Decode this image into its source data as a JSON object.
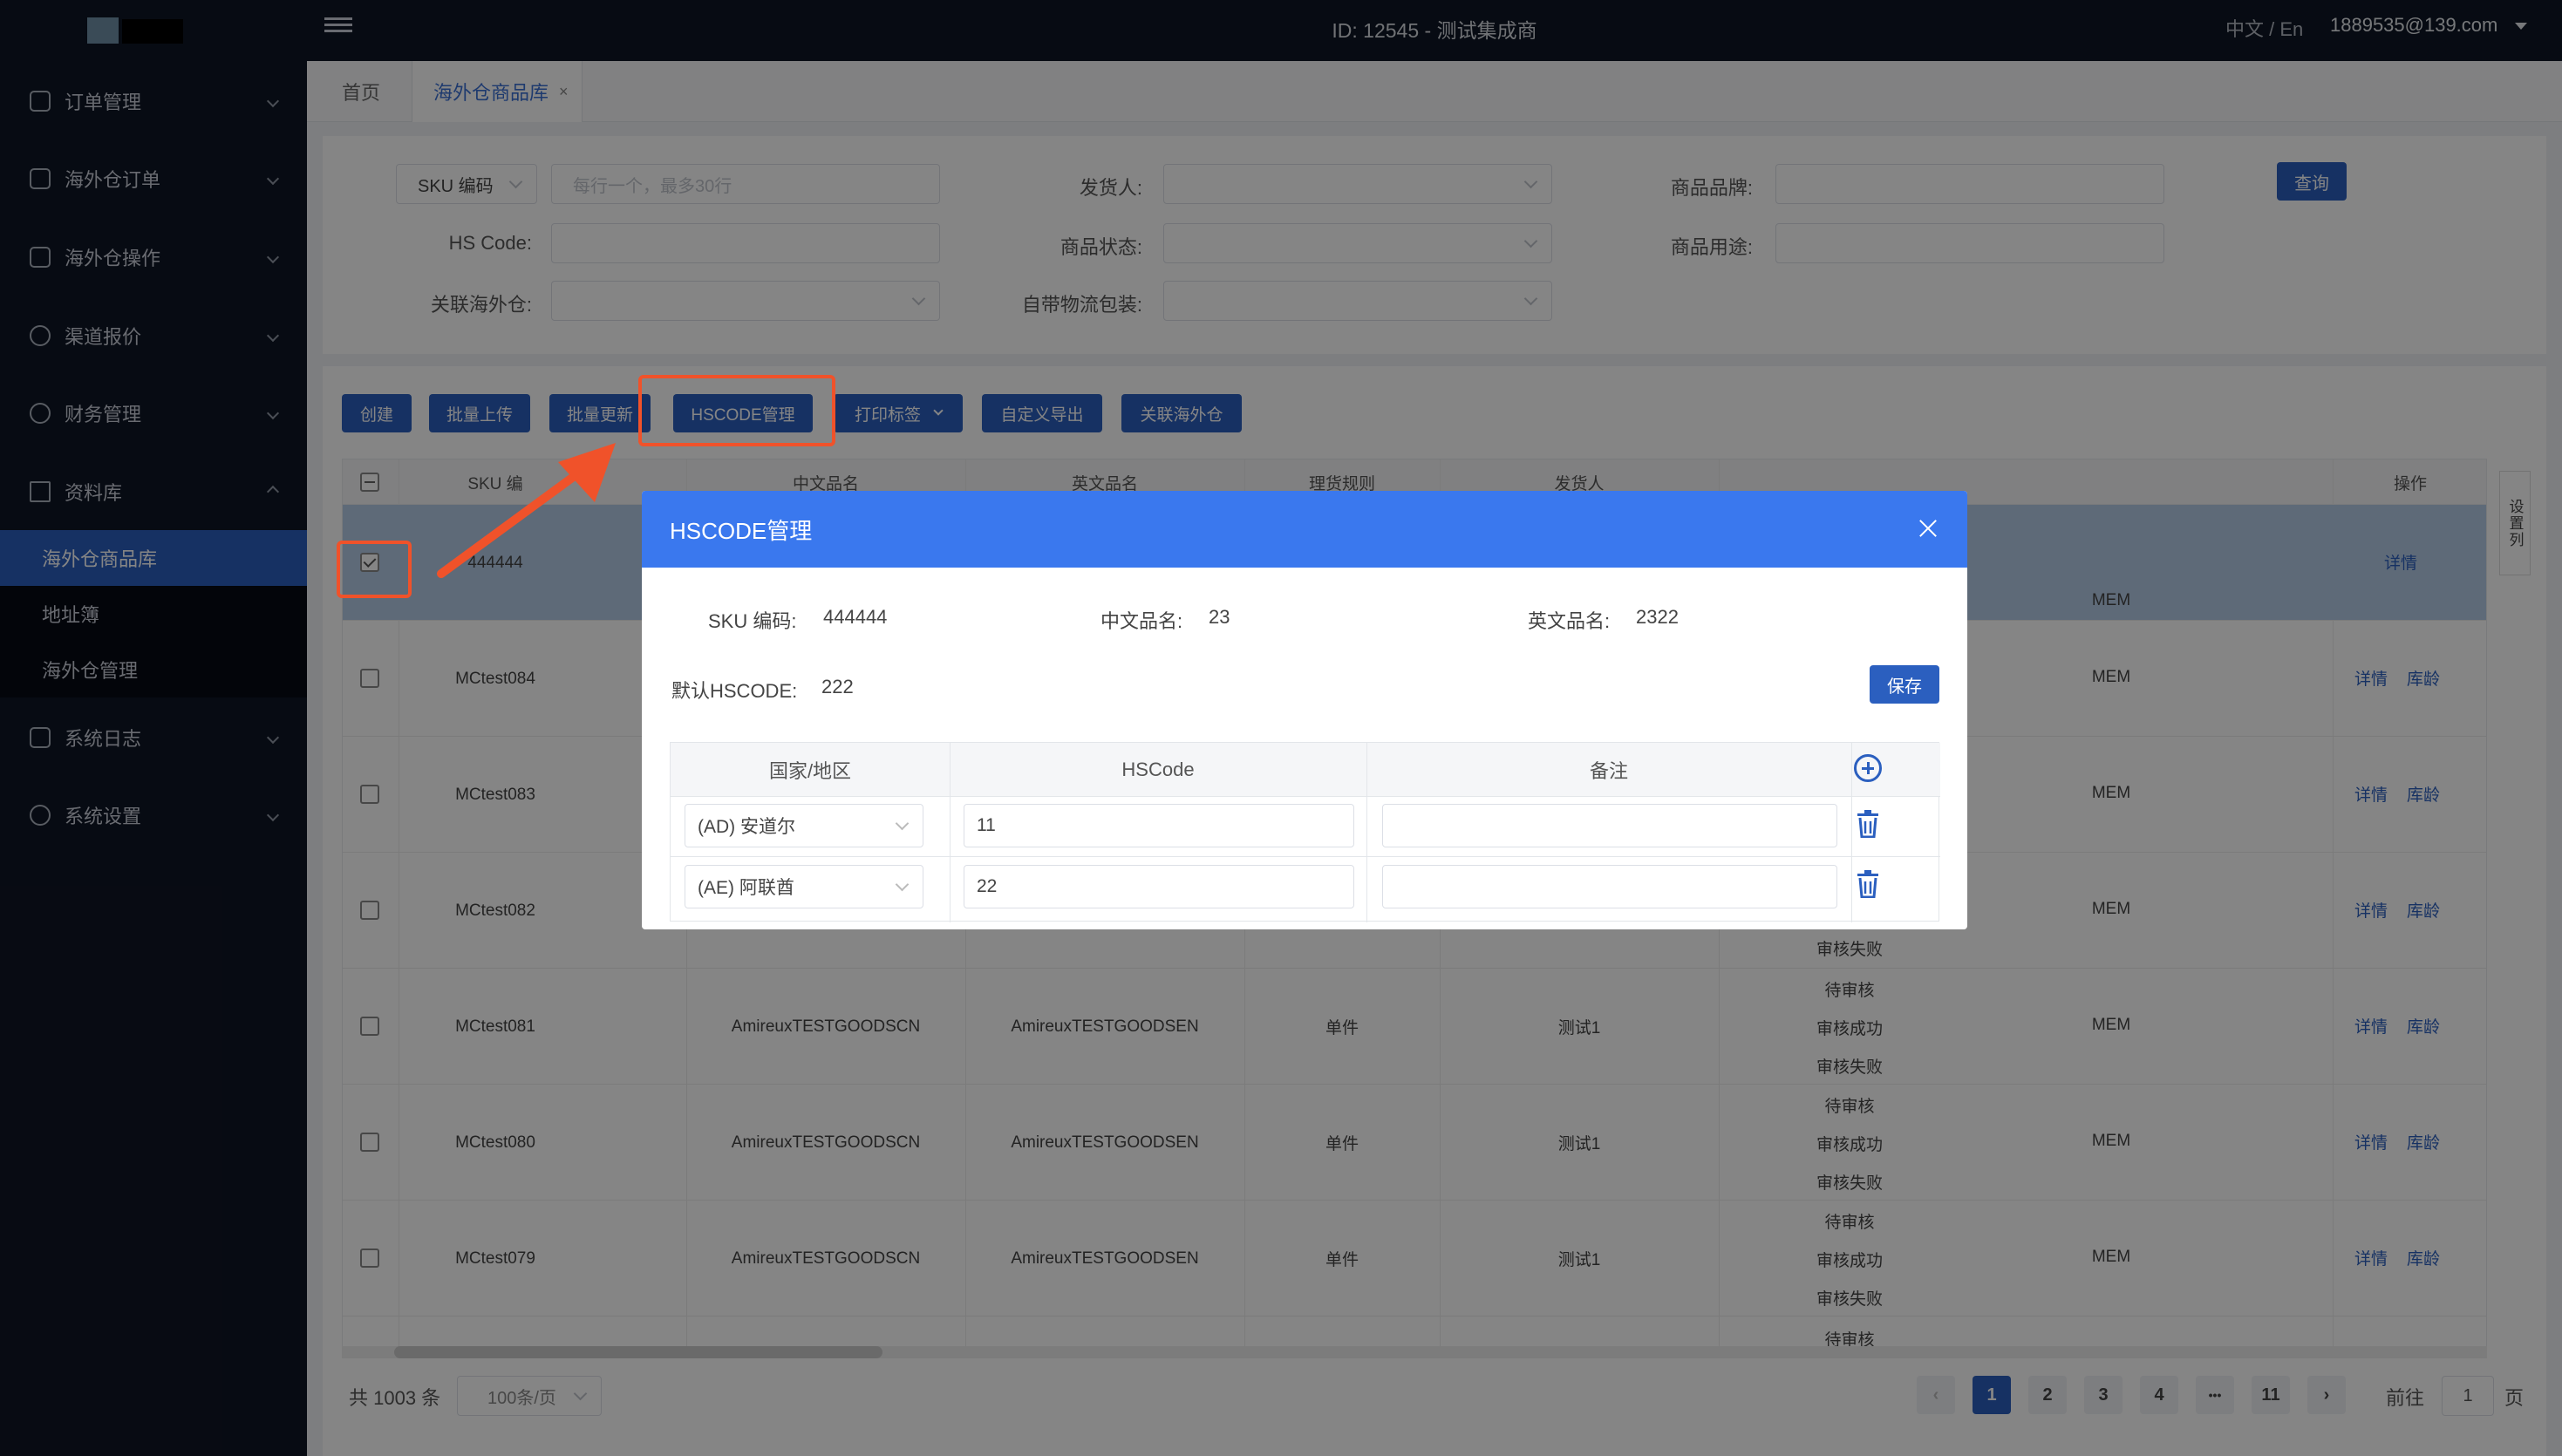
{
  "sidebar": {
    "items": [
      {
        "label": "订单管理",
        "icon": "order-icon"
      },
      {
        "label": "海外仓订单",
        "icon": "doc-icon"
      },
      {
        "label": "海外仓操作",
        "icon": "warehouse-icon"
      },
      {
        "label": "渠道报价",
        "icon": "channel-icon"
      },
      {
        "label": "财务管理",
        "icon": "yen-icon"
      },
      {
        "label": "资料库",
        "icon": "grid-icon"
      },
      {
        "label": "系统日志",
        "icon": "log-icon"
      },
      {
        "label": "系统设置",
        "icon": "gear-icon"
      }
    ],
    "subitems": [
      "海外仓商品库",
      "地址簿",
      "海外仓管理"
    ]
  },
  "topbar": {
    "title": "ID: 12545 - 测试集成商",
    "lang": "中文 / En",
    "user": "1889535@139.com"
  },
  "tabs": [
    {
      "label": "首页"
    },
    {
      "label": "海外仓商品库",
      "close": "×"
    }
  ],
  "filter": {
    "sku_select": "SKU 编码",
    "sku_placeholder": "每行一个，最多30行",
    "shipper_label": "发货人:",
    "brand_label": "商品品牌:",
    "hscode_label": "HS Code:",
    "status_label": "商品状态:",
    "usage_label": "商品用途:",
    "warehouse_label": "关联海外仓:",
    "packaging_label": "自带物流包装:",
    "query_label": "查询"
  },
  "actions": {
    "create": "创建",
    "batch_upload": "批量上传",
    "batch_update": "批量更新",
    "hscode": "HSCODE管理",
    "print": "打印标签",
    "export": "自定义导出",
    "link_wh": "关联海外仓"
  },
  "table": {
    "headers": [
      "SKU 编",
      "中文品名",
      "英文品名",
      "理货规则",
      "发货人",
      "操作"
    ],
    "settings": "设置列",
    "rows": [
      {
        "sku": "444444",
        "cn": "",
        "en": "",
        "rule": "",
        "shipper": "",
        "status": [],
        "tag": "MEM",
        "ops": [
          "详情"
        ]
      },
      {
        "sku": "MCtest084",
        "cn": "",
        "en": "",
        "rule": "",
        "shipper": "",
        "status": [],
        "tag": "MEM",
        "ops": [
          "详情",
          "库龄"
        ]
      },
      {
        "sku": "MCtest083",
        "cn": "",
        "en": "",
        "rule": "",
        "shipper": "",
        "status": [],
        "tag": "MEM",
        "ops": [
          "详情",
          "库龄"
        ]
      },
      {
        "sku": "MCtest082",
        "cn": "",
        "en": "",
        "rule": "",
        "shipper": "",
        "status": [
          "审核失败"
        ],
        "tag": "MEM",
        "ops": [
          "详情",
          "库龄"
        ]
      },
      {
        "sku": "MCtest081",
        "cn": "AmireuxTESTGOODSCN",
        "en": "AmireuxTESTGOODSEN",
        "rule": "单件",
        "shipper": "测试1",
        "status": [
          "待审核",
          "审核成功",
          "审核失败"
        ],
        "tag": "MEM",
        "ops": [
          "详情",
          "库龄"
        ]
      },
      {
        "sku": "MCtest080",
        "cn": "AmireuxTESTGOODSCN",
        "en": "AmireuxTESTGOODSEN",
        "rule": "单件",
        "shipper": "测试1",
        "status": [
          "待审核",
          "审核成功",
          "审核失败"
        ],
        "tag": "MEM",
        "ops": [
          "详情",
          "库龄"
        ]
      },
      {
        "sku": "MCtest079",
        "cn": "AmireuxTESTGOODSCN",
        "en": "AmireuxTESTGOODSEN",
        "rule": "单件",
        "shipper": "测试1",
        "status": [
          "待审核",
          "审核成功",
          "审核失败"
        ],
        "tag": "MEM",
        "ops": [
          "详情",
          "库龄"
        ]
      }
    ],
    "trailing_status": "待审核"
  },
  "pagination": {
    "total": "共 1003 条",
    "size": "100条/页",
    "pages": [
      "1",
      "2",
      "3",
      "4",
      "•••",
      "11"
    ],
    "goto": "前往",
    "page_input": "1",
    "page_suffix": "页"
  },
  "modal": {
    "title": "HSCODE管理",
    "sku_label": "SKU 编码:",
    "sku_value": "444444",
    "cn_label": "中文品名:",
    "cn_value": "23",
    "en_label": "英文品名:",
    "en_value": "2322",
    "default_label": "默认HSCODE:",
    "default_value": "222",
    "save": "保存",
    "headers": [
      "国家/地区",
      "HSCode",
      "备注"
    ],
    "rows": [
      {
        "country": "(AD) 安道尔",
        "hscode": "11",
        "note": ""
      },
      {
        "country": "(AE) 阿联酋",
        "hscode": "22",
        "note": ""
      }
    ]
  },
  "colors": {
    "accent": "#2b5fbf",
    "modal_header": "#3a78ee",
    "highlight": "#f0522a",
    "sidebar": "#0f1625"
  }
}
